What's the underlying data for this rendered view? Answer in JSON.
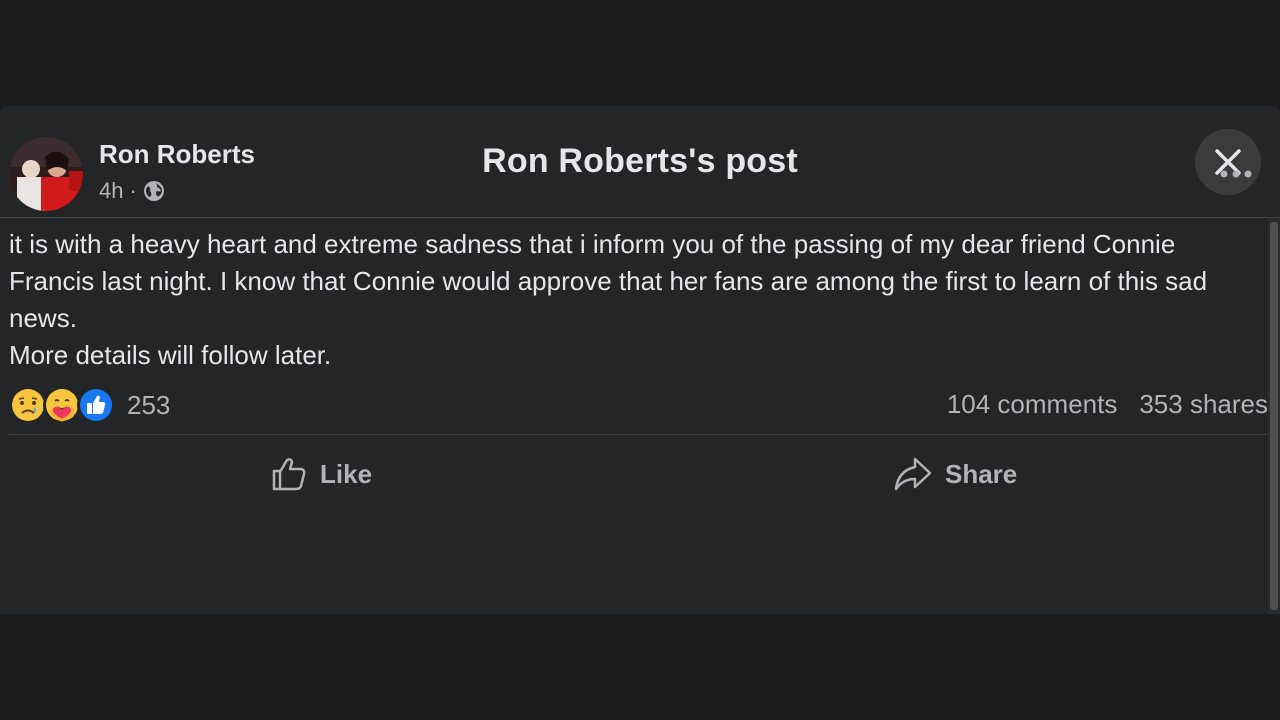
{
  "modal": {
    "title": "Ron Roberts's post",
    "close_icon": "close-icon"
  },
  "post": {
    "author": "Ron Roberts",
    "time": "4h",
    "separator": "·",
    "privacy_icon": "globe-icon",
    "more_icon": "more-options-icon",
    "text_lines": [
      "it is with a heavy heart and extreme sadness that i inform you of the passing of my dear friend Connie Francis last night. I know that Connie would approve that her fans are among the first to learn of this sad news.",
      "More details will follow later."
    ],
    "reactions": {
      "icons": [
        "sad-reaction-icon",
        "care-reaction-icon",
        "like-reaction-icon"
      ],
      "count": "253"
    },
    "comments": "104 comments",
    "shares": "353 shares"
  },
  "actions": {
    "like_label": "Like",
    "share_label": "Share"
  },
  "colors": {
    "background": "#18191a",
    "card": "#242526",
    "text_primary": "#e4e6eb",
    "text_secondary": "#b0b3b8",
    "like_blue": "#1877f2"
  }
}
